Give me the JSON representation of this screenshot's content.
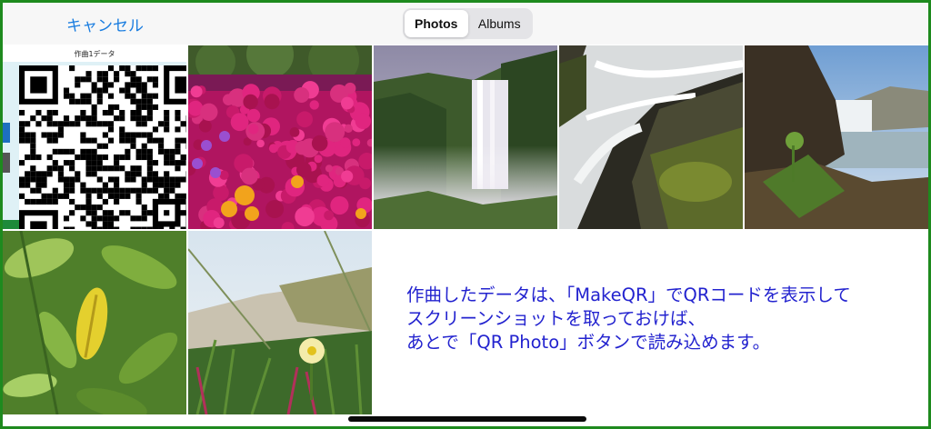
{
  "navbar": {
    "cancel_label": "キャンセル",
    "segments": [
      {
        "label": "Photos",
        "selected": true
      },
      {
        "label": "Albums",
        "selected": false
      }
    ]
  },
  "photos": [
    {
      "kind": "qr-screenshot",
      "title": "作曲1データ"
    },
    {
      "kind": "pink-flowers"
    },
    {
      "kind": "waterfall-cliff"
    },
    {
      "kind": "waterfall-rocks"
    },
    {
      "kind": "waterfall-coast"
    },
    {
      "kind": "green-leaves"
    },
    {
      "kind": "dune-flower"
    }
  ],
  "instruction": {
    "lines": [
      "作曲したデータは、「MakeQR」でQRコードを表示して",
      "スクリーンショットを取っておけば、",
      "あとで「QR Photo」ボタンで読み込めます。"
    ]
  },
  "colors": {
    "frame": "#1e8a1e",
    "accent": "#1a7de0",
    "instruction_text": "#2323cf"
  }
}
